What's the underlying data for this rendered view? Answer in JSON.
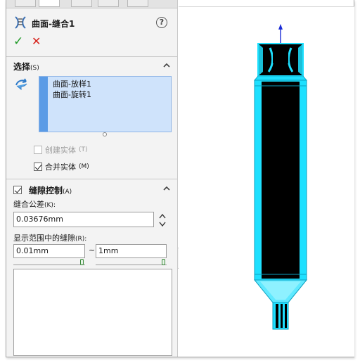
{
  "panel": {
    "title": "曲面-缝合1",
    "help": "?",
    "ok": "✓",
    "cancel": "✕"
  },
  "selection": {
    "heading": "选择",
    "heading_key": "(S)",
    "items": [
      "曲面-放样1",
      "曲面-旋转1"
    ],
    "create_solid": {
      "label": "创建实体",
      "key": "(T)",
      "checked": false,
      "enabled": false
    },
    "merge_entities": {
      "label": "合并实体",
      "key": "(M)",
      "checked": true,
      "enabled": true
    }
  },
  "gap_control": {
    "heading": "缝隙控制",
    "heading_key": "(A)",
    "checked": true,
    "tolerance_label": "缝合公差",
    "tolerance_key": "(K):",
    "tolerance_value": "0.03676mm",
    "range_label": "显示范围中的缝隙",
    "range_key": "(R):",
    "range_min": "0.01mm",
    "range_sep": "~",
    "range_max": "1mm",
    "range_min_slider": 1.0,
    "range_max_slider": 1.0
  },
  "colors": {
    "accent": "#5a9be6",
    "model_cyan": "#1ee0ff",
    "model_black": "#000000",
    "ok_green": "#1f9a27",
    "cancel_red": "#d6231c"
  },
  "icons": [
    "knit-surface-icon",
    "help-icon",
    "ok-icon",
    "cancel-icon",
    "chevron-up-icon",
    "selection-arrow-icon",
    "spinner-icon",
    "triad-arrow-icon"
  ]
}
